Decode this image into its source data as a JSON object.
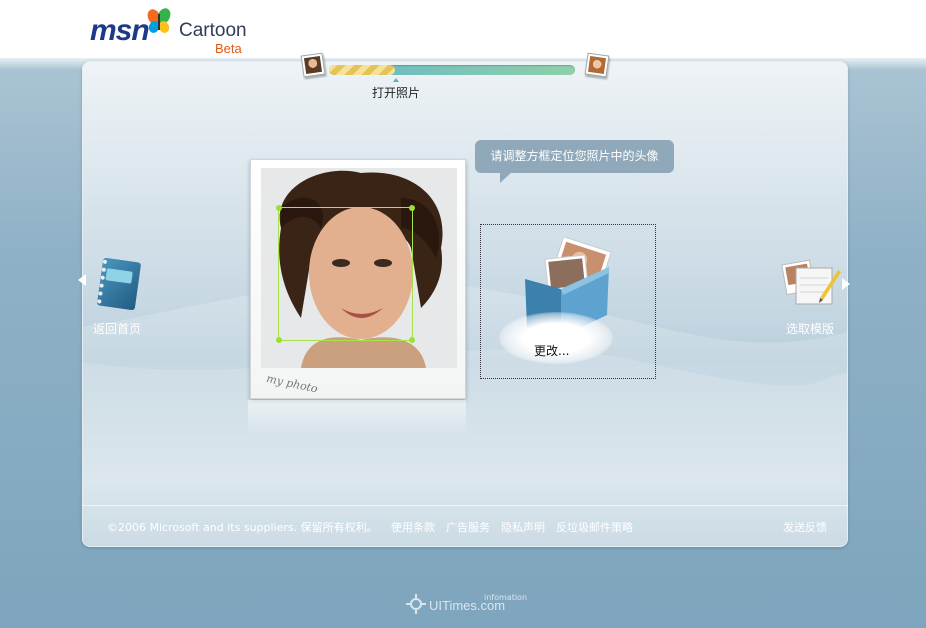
{
  "header": {
    "brand": "msn",
    "product": "Cartoon",
    "tag": "Beta"
  },
  "progress": {
    "step_label": "打开照片",
    "value": 0.27
  },
  "tooltip": {
    "text": "请调整方框定位您照片中的头像"
  },
  "photo": {
    "caption": "my photo"
  },
  "change": {
    "label": "更改..."
  },
  "nav": {
    "back_label": "返回首页",
    "next_label": "选取模版"
  },
  "footer": {
    "copyright": "©2006 Microsoft and its suppliers. 保留所有权利。",
    "links": [
      "使用条款",
      "广告服务",
      "隐私声明",
      "反垃圾邮件策略"
    ],
    "feedback": "发送反馈"
  },
  "watermark": {
    "text": "UITimes.com",
    "sub": "infomation"
  },
  "colors": {
    "accent": "#1d3a87",
    "beta": "#e15a13",
    "crop": "#a8e24b",
    "tooltip": "#8fa9bb"
  }
}
